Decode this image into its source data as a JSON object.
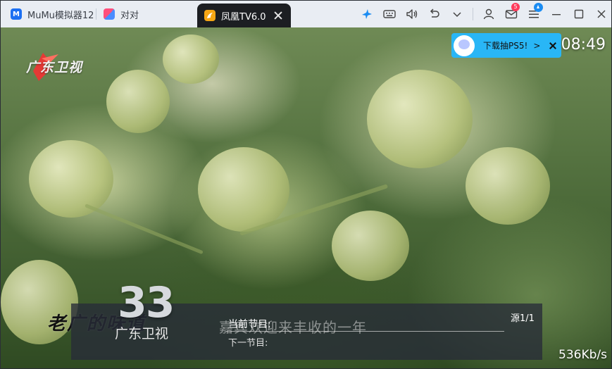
{
  "tabs": [
    {
      "label": "MuMu模拟器12",
      "icon": "mumu-app-icon"
    },
    {
      "label": "对对",
      "icon": "duidui-app-icon"
    },
    {
      "label": "凤凰TV6.0",
      "icon": "phoenix-tv-icon",
      "active": true
    }
  ],
  "toolbar": {
    "mail_badge": "5"
  },
  "player": {
    "station_logo_text": "广东卫视",
    "clock": "08:49",
    "channel_number": "33",
    "channel_name": "广东卫视",
    "caption_ghost": "嘉宾欢迎来丰收的一年",
    "now_playing_label": "当前节目:",
    "next_label": "下一节目:",
    "source": "源1/1",
    "speed": "536Kb/s",
    "watermark_text": "老广的味道"
  },
  "ad": {
    "text": "下载抽PS5!",
    "arrow": ">"
  },
  "colors": {
    "titlebar_bg": "#e9edf3",
    "active_tab_bg": "#1c1e22",
    "ad_bg": "#29b6f6",
    "badge": "#ff3b5c",
    "accent": "#1b8cf2"
  }
}
